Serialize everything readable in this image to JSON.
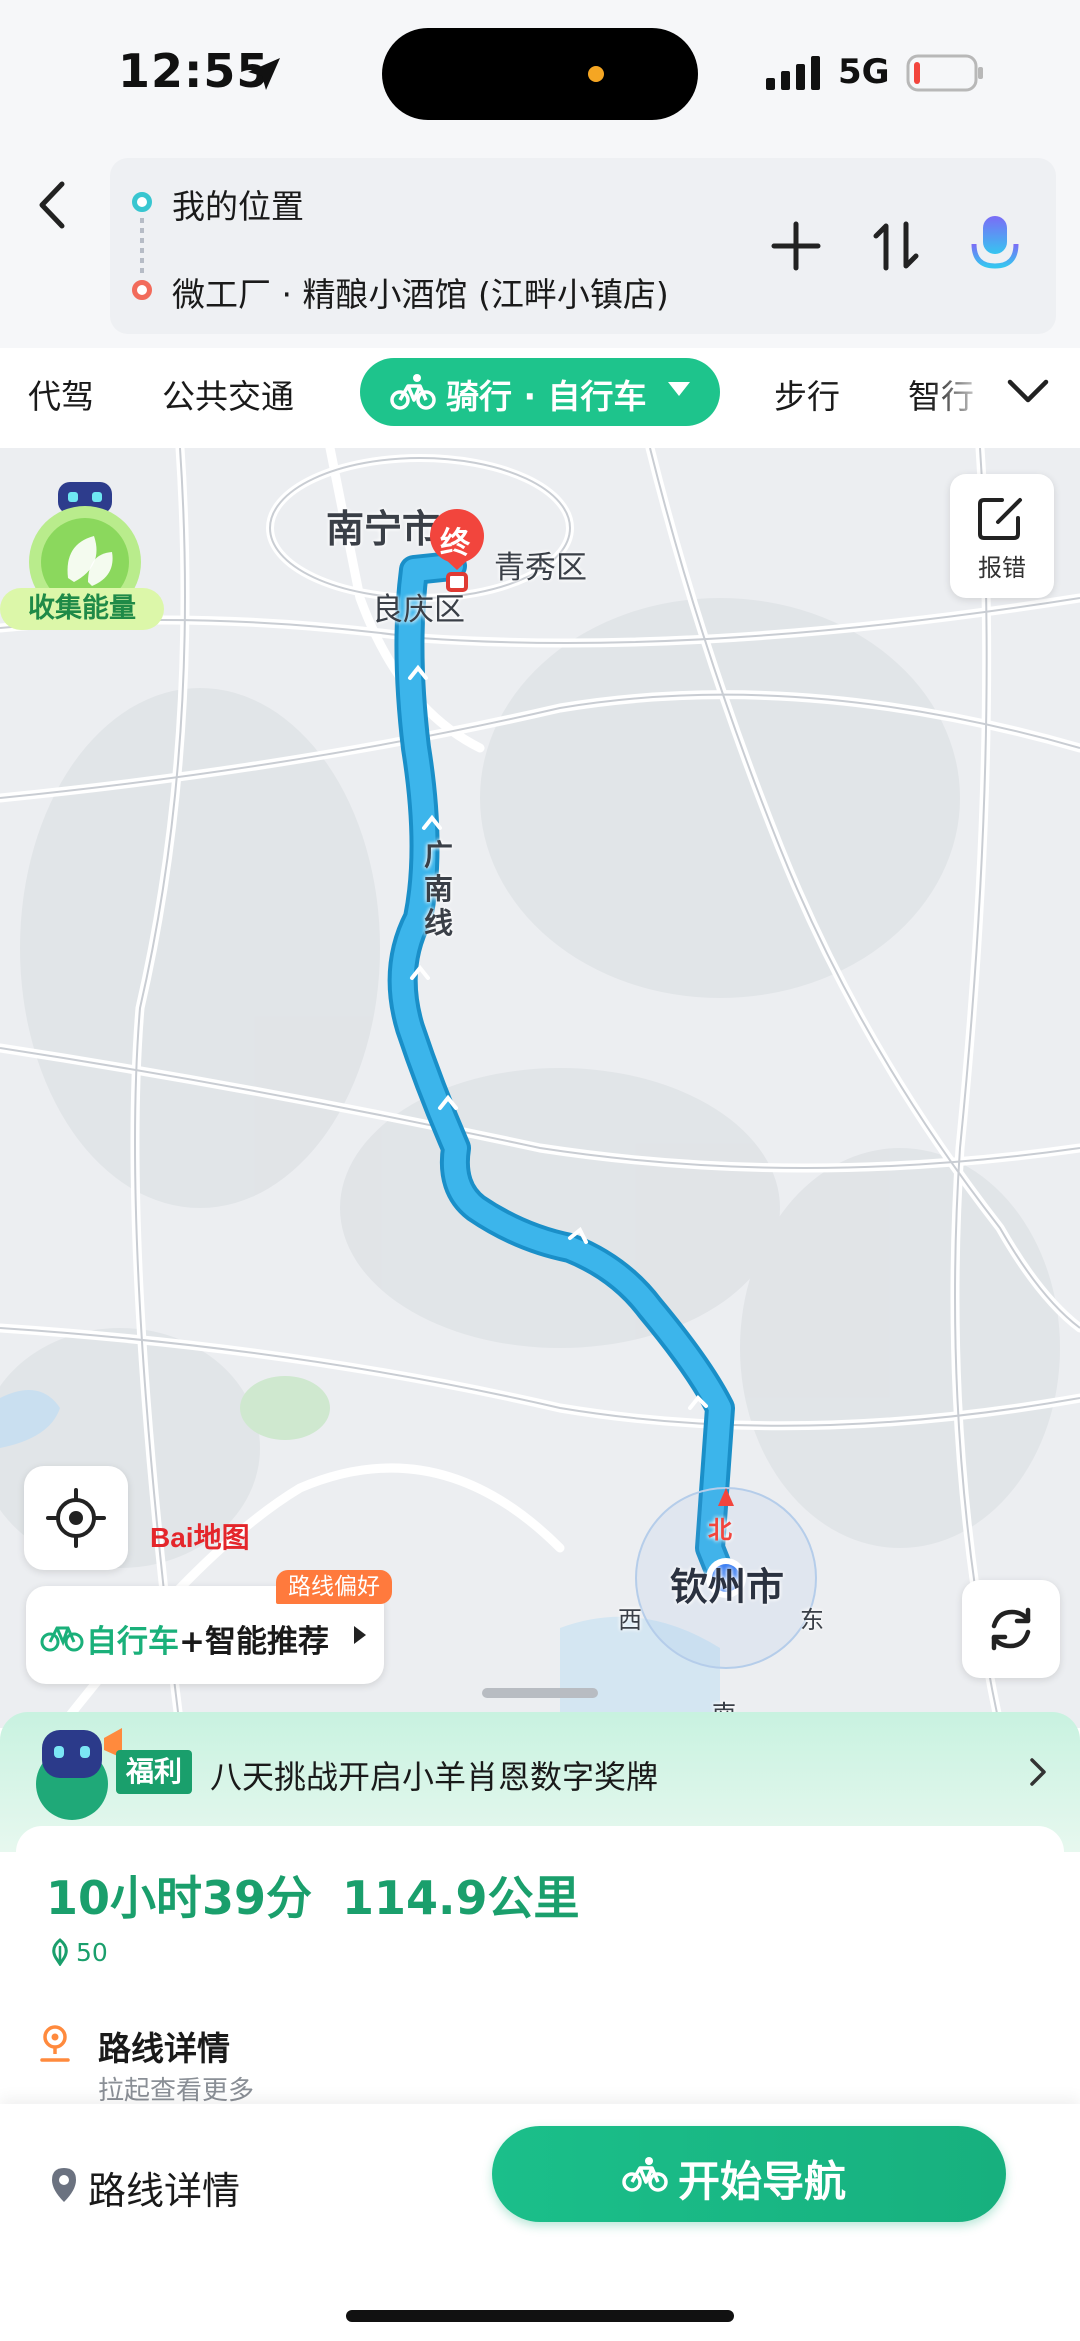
{
  "status_bar": {
    "time": "12:55",
    "network": "5G"
  },
  "route_input": {
    "start": "我的位置",
    "end": "微工厂 · 精酿小酒馆 (江畔小镇店)"
  },
  "modes": {
    "tabs": [
      "代驾",
      "公共交通",
      "步行",
      "智行"
    ],
    "active": "骑行 · 自行车"
  },
  "map": {
    "cities": {
      "nanning": "南宁市",
      "qinzhou": "钦州市"
    },
    "districts": {
      "qingxiu": "青秀区",
      "liangqing": "良庆区"
    },
    "road": [
      "广",
      "南",
      "线"
    ],
    "end_marker": "终",
    "compass": {
      "north": "北",
      "east": "东",
      "west": "西",
      "south": "南"
    },
    "energy_label": "收集能量",
    "report_label": "报错",
    "brand": "Bai地图",
    "route_pref_badge": "路线偏好",
    "bike_pref": {
      "mode": "自行车",
      "plus": "+",
      "recommend": "智能推荐"
    }
  },
  "promo": {
    "tag": "福利",
    "text": "八天挑战开启小羊肖恩数字奖牌"
  },
  "summary": {
    "time": "10小时39分",
    "distance": "114.9公里",
    "energy": "50"
  },
  "route_detail": {
    "title": "路线详情",
    "subtitle": "拉起查看更多"
  },
  "actions": {
    "detail": "路线详情",
    "navigate": "开始导航"
  },
  "colors": {
    "accent": "#1ec48c",
    "route": "#34aee0",
    "end": "#f2453d"
  }
}
